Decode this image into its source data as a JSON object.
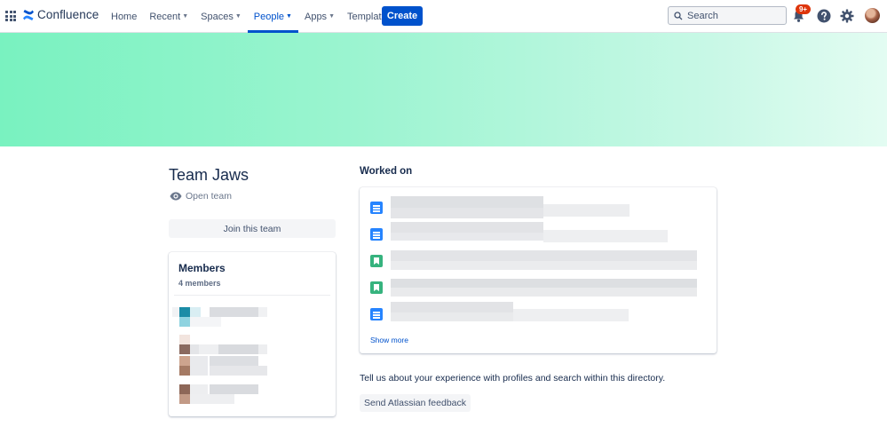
{
  "nav": {
    "product_name": "Confluence",
    "items": [
      {
        "label": "Home",
        "has_dropdown": false,
        "active": false
      },
      {
        "label": "Recent",
        "has_dropdown": true,
        "active": false
      },
      {
        "label": "Spaces",
        "has_dropdown": true,
        "active": false
      },
      {
        "label": "People",
        "has_dropdown": true,
        "active": true
      },
      {
        "label": "Apps",
        "has_dropdown": true,
        "active": false
      },
      {
        "label": "Templates",
        "has_dropdown": false,
        "active": false
      }
    ],
    "create_label": "Create",
    "search_placeholder": "Search",
    "notification_badge": "9+"
  },
  "team": {
    "name": "Team Jaws",
    "visibility": "Open team",
    "join_label": "Join this team"
  },
  "members": {
    "title": "Members",
    "count_label": "4 members"
  },
  "worked_on": {
    "title": "Worked on",
    "items": [
      {
        "icon": "page-icon"
      },
      {
        "icon": "page-icon"
      },
      {
        "icon": "blog-icon"
      },
      {
        "icon": "blog-icon"
      },
      {
        "icon": "page-icon"
      }
    ],
    "show_more_label": "Show more"
  },
  "feedback": {
    "prompt": "Tell us about your experience with profiles and search within this directory.",
    "button_label": "Send Atlassian feedback"
  },
  "colors": {
    "brand_blue": "#0052CC",
    "banner_start": "#79F2C0",
    "banner_end": "#E3FCF2",
    "badge_red": "#DE350B",
    "page_icon": "#2684FF",
    "blog_icon": "#36B37E"
  }
}
